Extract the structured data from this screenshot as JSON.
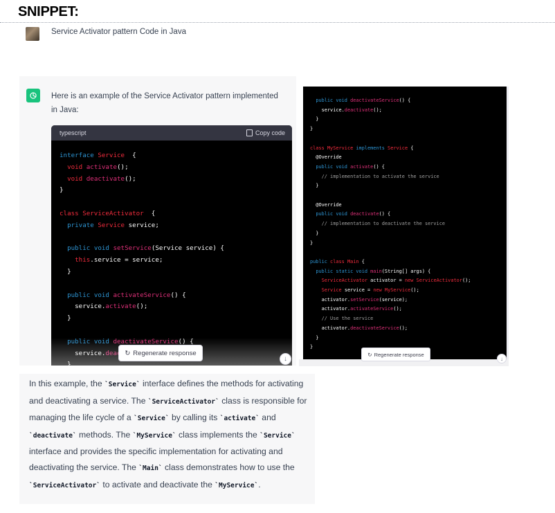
{
  "page_heading": "SNIPPET:",
  "user_message": "Service Activator pattern Code in Java",
  "assistant": {
    "intro": "Here is an example of the Service Activator pattern implemented in Java:",
    "code_language": "typescript",
    "copy_label": "Copy code",
    "regenerate_label": "Regenerate response",
    "explanation": [
      {
        "text": "In this example, the "
      },
      {
        "code": "`Service`"
      },
      {
        "text": " interface defines the methods for activating and deactivating a service. The "
      },
      {
        "code": "`ServiceActivator`"
      },
      {
        "text": " class is responsible for managing the life cycle of a "
      },
      {
        "code": "`Service`"
      },
      {
        "text": " by calling its "
      },
      {
        "code": "`activate`"
      },
      {
        "text": " and "
      },
      {
        "code": "`deactivate`"
      },
      {
        "text": " methods. The "
      },
      {
        "code": "`MyService`"
      },
      {
        "text": " class implements the "
      },
      {
        "code": "`Service`"
      },
      {
        "text": " interface and provides the specific implementation for activating and deactivating the service. The "
      },
      {
        "code": "`Main`"
      },
      {
        "text": " class demonstrates how to use the "
      },
      {
        "code": "`ServiceActivator`"
      },
      {
        "text": " to activate and deactivate the "
      },
      {
        "code": "`MyService`"
      },
      {
        "text": "."
      }
    ]
  },
  "code_left": [
    [
      [
        "k",
        "interface "
      ],
      [
        "t",
        "Service"
      ],
      [
        "",
        "  {"
      ]
    ],
    [
      [
        "",
        "  "
      ],
      [
        "t",
        "void "
      ],
      [
        "f",
        "activate"
      ],
      [
        "",
        "();"
      ]
    ],
    [
      [
        "",
        "  "
      ],
      [
        "t",
        "void "
      ],
      [
        "f",
        "deactivate"
      ],
      [
        "",
        "();"
      ]
    ],
    [
      [
        "",
        "}"
      ]
    ],
    [
      [
        "",
        ""
      ]
    ],
    [
      [
        "t",
        "class "
      ],
      [
        "t",
        "ServiceActivator"
      ],
      [
        "",
        "  {"
      ]
    ],
    [
      [
        "",
        "  "
      ],
      [
        "k",
        "private "
      ],
      [
        "t",
        "Service "
      ],
      [
        "",
        "service;"
      ]
    ],
    [
      [
        "",
        ""
      ]
    ],
    [
      [
        "",
        "  "
      ],
      [
        "k",
        "public "
      ],
      [
        "k",
        "void "
      ],
      [
        "f",
        "setService"
      ],
      [
        "",
        "(Service service) {"
      ]
    ],
    [
      [
        "",
        "    "
      ],
      [
        "t",
        "this"
      ],
      [
        "",
        ".service = service;"
      ]
    ],
    [
      [
        "",
        "  }"
      ]
    ],
    [
      [
        "",
        ""
      ]
    ],
    [
      [
        "",
        "  "
      ],
      [
        "k",
        "public "
      ],
      [
        "k",
        "void "
      ],
      [
        "f",
        "activateService"
      ],
      [
        "",
        "() {"
      ]
    ],
    [
      [
        "",
        "    service."
      ],
      [
        "f",
        "activate"
      ],
      [
        "",
        "();"
      ]
    ],
    [
      [
        "",
        "  }"
      ]
    ],
    [
      [
        "",
        ""
      ]
    ],
    [
      [
        "",
        "  "
      ],
      [
        "k",
        "public "
      ],
      [
        "k",
        "void "
      ],
      [
        "f",
        "deactivateService"
      ],
      [
        "",
        "() {"
      ]
    ],
    [
      [
        "",
        "    service."
      ],
      [
        "f",
        "deac"
      ]
    ],
    [
      [
        "",
        "  }"
      ]
    ]
  ],
  "code_right": [
    [
      [
        "",
        "  "
      ],
      [
        "k",
        "public "
      ],
      [
        "k",
        "void "
      ],
      [
        "f",
        "deactivateService"
      ],
      [
        "",
        "() {"
      ]
    ],
    [
      [
        "",
        "    service."
      ],
      [
        "f",
        "deactivate"
      ],
      [
        "",
        "();"
      ]
    ],
    [
      [
        "",
        "  }"
      ]
    ],
    [
      [
        "",
        "}"
      ]
    ],
    [
      [
        "",
        ""
      ]
    ],
    [
      [
        "t",
        "class "
      ],
      [
        "t",
        "MyService "
      ],
      [
        "k",
        "implements "
      ],
      [
        "t",
        "Service"
      ],
      [
        "",
        " {"
      ]
    ],
    [
      [
        "",
        "  @Override"
      ]
    ],
    [
      [
        "",
        "  "
      ],
      [
        "k",
        "public "
      ],
      [
        "k",
        "void "
      ],
      [
        "f",
        "activate"
      ],
      [
        "",
        "() {"
      ]
    ],
    [
      [
        "",
        "    "
      ],
      [
        "c",
        "// implementation to activate the service"
      ]
    ],
    [
      [
        "",
        "  }"
      ]
    ],
    [
      [
        "",
        ""
      ]
    ],
    [
      [
        "",
        "  @Override"
      ]
    ],
    [
      [
        "",
        "  "
      ],
      [
        "k",
        "public "
      ],
      [
        "k",
        "void "
      ],
      [
        "f",
        "deactivate"
      ],
      [
        "",
        "() {"
      ]
    ],
    [
      [
        "",
        "    "
      ],
      [
        "c",
        "// implementation to deactivate the service"
      ]
    ],
    [
      [
        "",
        "  }"
      ]
    ],
    [
      [
        "",
        "}"
      ]
    ],
    [
      [
        "",
        ""
      ]
    ],
    [
      [
        "k",
        "public "
      ],
      [
        "t",
        "class "
      ],
      [
        "t",
        "Main"
      ],
      [
        "",
        " {"
      ]
    ],
    [
      [
        "",
        "  "
      ],
      [
        "k",
        "public "
      ],
      [
        "k",
        "static "
      ],
      [
        "k",
        "void "
      ],
      [
        "f",
        "main"
      ],
      [
        "",
        "(String[] args) {"
      ]
    ],
    [
      [
        "",
        "    "
      ],
      [
        "t",
        "ServiceActivator "
      ],
      [
        "",
        "activator = "
      ],
      [
        "t",
        "new "
      ],
      [
        "t",
        "ServiceActivator"
      ],
      [
        "",
        "();"
      ]
    ],
    [
      [
        "",
        "    "
      ],
      [
        "t",
        "Service "
      ],
      [
        "",
        "service = "
      ],
      [
        "t",
        "new "
      ],
      [
        "t",
        "MyService"
      ],
      [
        "",
        "();"
      ]
    ],
    [
      [
        "",
        "    activator."
      ],
      [
        "f",
        "setService"
      ],
      [
        "",
        "(service);"
      ]
    ],
    [
      [
        "",
        "    activator."
      ],
      [
        "f",
        "activateService"
      ],
      [
        "",
        "();"
      ]
    ],
    [
      [
        "",
        "    "
      ],
      [
        "c",
        "// Use the service"
      ]
    ],
    [
      [
        "",
        "    activator."
      ],
      [
        "f",
        "deactivateService"
      ],
      [
        "",
        "();"
      ]
    ],
    [
      [
        "",
        "  }"
      ]
    ],
    [
      [
        "",
        "}"
      ]
    ]
  ],
  "colors": {
    "keyword": "#2e95d3",
    "type": "#f22c3d",
    "function": "#df3079",
    "comment": "#a0a0a0",
    "openai_green": "#19c37d"
  },
  "icons": [
    "openai-logo-icon",
    "copy-icon",
    "refresh-icon",
    "arrow-down-icon"
  ]
}
